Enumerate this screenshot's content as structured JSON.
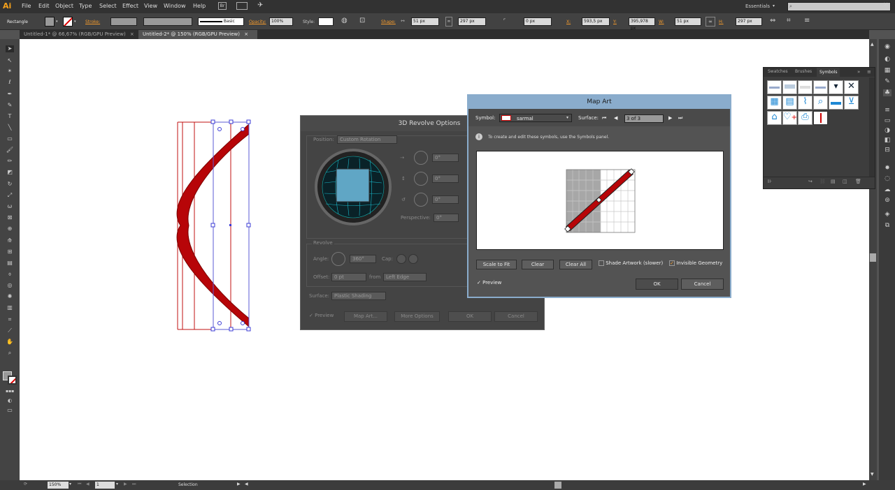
{
  "app": {
    "logo": "Ai"
  },
  "menu": [
    "File",
    "Edit",
    "Object",
    "Type",
    "Select",
    "Effect",
    "View",
    "Window",
    "Help"
  ],
  "workspace": {
    "label": "Essentials",
    "bridge": "Br"
  },
  "control": {
    "selection_type": "Rectangle",
    "stroke_label": "Stroke:",
    "brush_label": "Basic",
    "opacity_label": "Opacity:",
    "opacity_value": "100%",
    "style_label": "Style:",
    "shape_label": "Shape:",
    "shape_w": "51 px",
    "shape_h": "297 px",
    "corner": "0 px",
    "x_label": "X:",
    "x_value": "593,5 px",
    "y_label": "Y:",
    "y_value": "395,978 px",
    "w_label": "W:",
    "w_value": "51 px",
    "h_label": "H:",
    "h_value": "297 px"
  },
  "tabs": [
    {
      "label": "Untitled-1* @ 66,67% (RGB/GPU Preview)",
      "close": "×"
    },
    {
      "label": "Untitled-2* @ 150% (RGB/GPU Preview)",
      "close": "×"
    }
  ],
  "revolve": {
    "title": "3D Revolve Options",
    "position_label": "Position:",
    "position_value": "Custom Rotation",
    "rot_x": "0°",
    "rot_y": "0°",
    "rot_z": "0°",
    "perspective_label": "Perspective:",
    "perspective_value": "0°",
    "revolve_label": "Revolve",
    "angle_label": "Angle:",
    "angle_value": "360°",
    "cap_label": "Cap:",
    "offset_label": "Offset:",
    "offset_value": "0 pt",
    "from_label": "from",
    "from_value": "Left Edge",
    "surface_label": "Surface:",
    "surface_value": "Plastic Shading",
    "preview_label": "Preview",
    "map_art_button": "Map Art...",
    "more_options_button": "More Options",
    "ok_button": "OK",
    "cancel_button": "Cancel"
  },
  "mapart": {
    "title": "Map Art",
    "symbol_label": "Symbol:",
    "symbol_value": "sarmal",
    "surface_label": "Surface:",
    "surface_value": "3 of 3",
    "info_text": "To create and edit these symbols, use the Symbols panel.",
    "scale_to_fit": "Scale to Fit",
    "clear": "Clear",
    "clear_all": "Clear All",
    "shade_artwork": "Shade Artwork (slower)",
    "invisible_geometry": "Invisible Geometry",
    "preview": "Preview",
    "ok": "OK",
    "cancel": "Cancel"
  },
  "symbols_panel": {
    "tabs": [
      "Swatches",
      "Brushes",
      "Symbols"
    ],
    "active_tab": "Symbols"
  },
  "status": {
    "zoom": "150%",
    "page": "1",
    "mode": "Selection"
  },
  "colors": {
    "accent": "#f39a2c",
    "dialog_title": "#8aaccc",
    "shape_red": "#b70508"
  }
}
